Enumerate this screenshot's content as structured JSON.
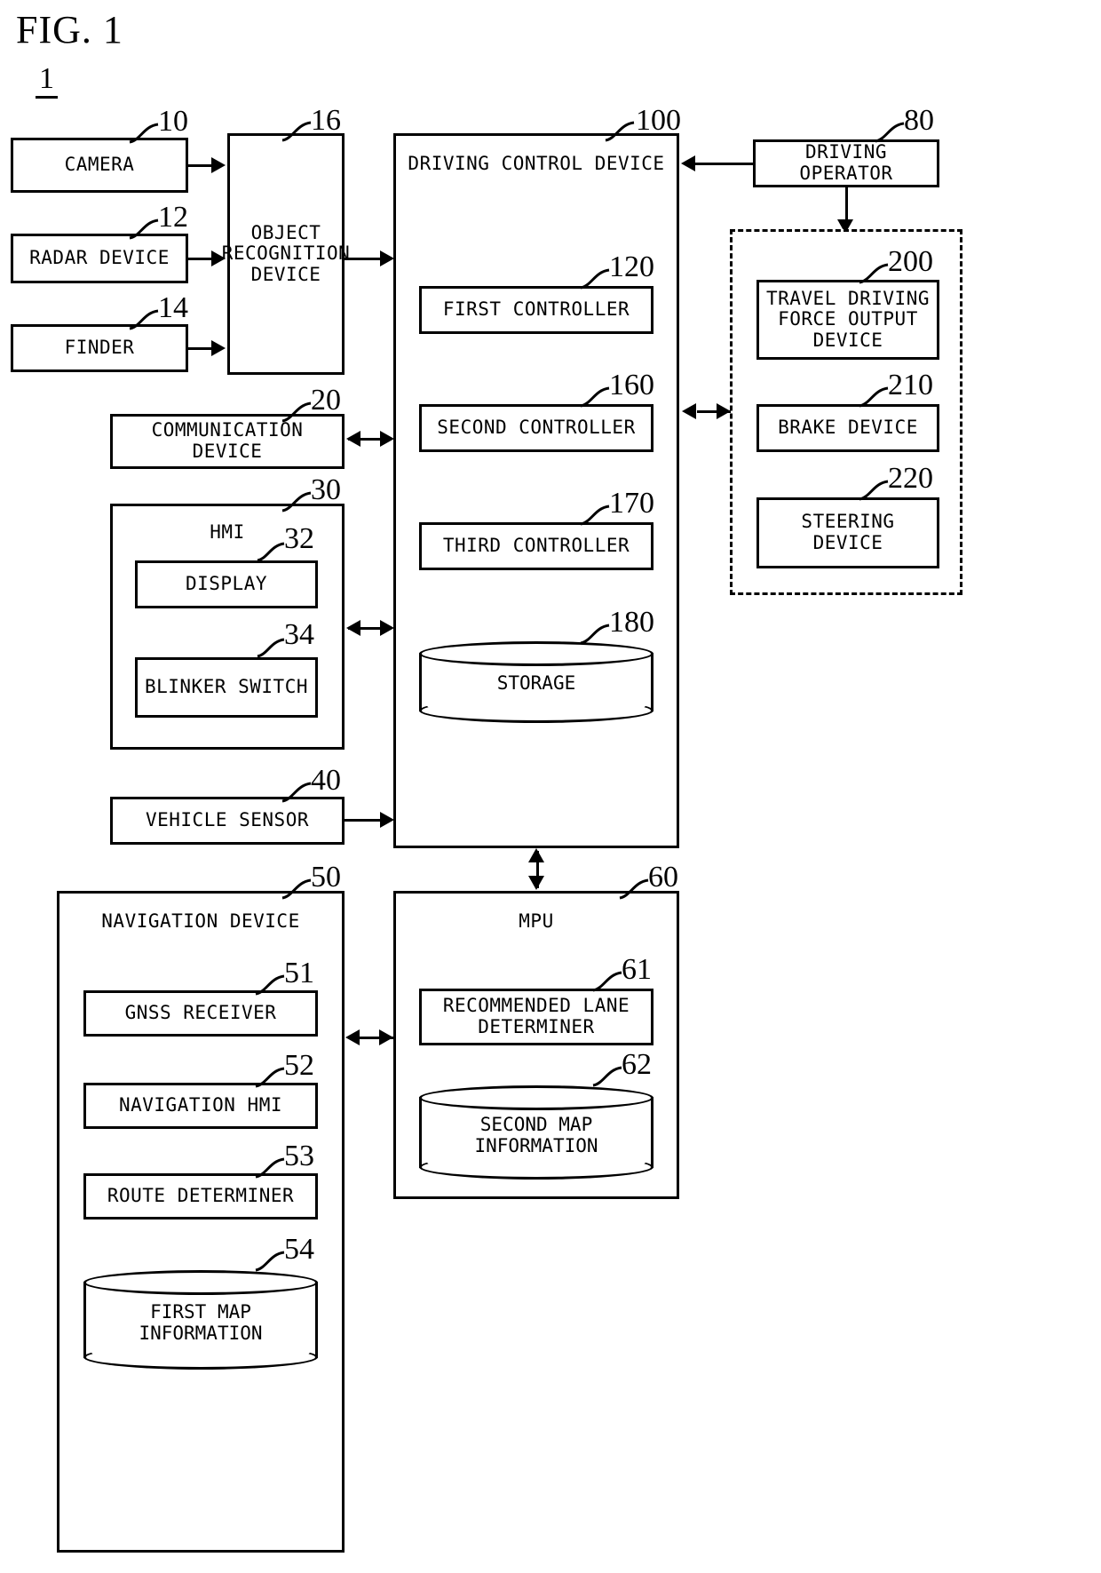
{
  "figure": {
    "title": "FIG. 1",
    "system_number": "1"
  },
  "blocks": {
    "camera": {
      "label": "CAMERA",
      "ref": "10"
    },
    "radar_device": {
      "label": "RADAR DEVICE",
      "ref": "12"
    },
    "finder": {
      "label": "FINDER",
      "ref": "14"
    },
    "object_recognition": {
      "label": "OBJECT\nRECOGNITION\nDEVICE",
      "ref": "16"
    },
    "communication_device": {
      "label": "COMMUNICATION\nDEVICE",
      "ref": "20"
    },
    "hmi": {
      "label": "HMI",
      "ref": "30"
    },
    "display": {
      "label": "DISPLAY",
      "ref": "32"
    },
    "blinker_switch": {
      "label": "BLINKER SWITCH",
      "ref": "34"
    },
    "vehicle_sensor": {
      "label": "VEHICLE SENSOR",
      "ref": "40"
    },
    "navigation_device": {
      "label": "NAVIGATION DEVICE",
      "ref": "50"
    },
    "gnss_receiver": {
      "label": "GNSS RECEIVER",
      "ref": "51"
    },
    "navigation_hmi": {
      "label": "NAVIGATION HMI",
      "ref": "52"
    },
    "route_determiner": {
      "label": "ROUTE DETERMINER",
      "ref": "53"
    },
    "first_map_information": {
      "label": "FIRST MAP\nINFORMATION",
      "ref": "54"
    },
    "mpu": {
      "label": "MPU",
      "ref": "60"
    },
    "recommended_lane": {
      "label": "RECOMMENDED LANE\nDETERMINER",
      "ref": "61"
    },
    "second_map_information": {
      "label": "SECOND MAP\nINFORMATION",
      "ref": "62"
    },
    "driving_operator": {
      "label": "DRIVING OPERATOR",
      "ref": "80"
    },
    "driving_control": {
      "label": "DRIVING CONTROL DEVICE",
      "ref": "100"
    },
    "first_controller": {
      "label": "FIRST CONTROLLER",
      "ref": "120"
    },
    "second_controller": {
      "label": "SECOND CONTROLLER",
      "ref": "160"
    },
    "third_controller": {
      "label": "THIRD CONTROLLER",
      "ref": "170"
    },
    "storage": {
      "label": "STORAGE",
      "ref": "180"
    },
    "travel_driving_force": {
      "label": "TRAVEL DRIVING\nFORCE OUTPUT\nDEVICE",
      "ref": "200"
    },
    "brake_device": {
      "label": "BRAKE DEVICE",
      "ref": "210"
    },
    "steering_device": {
      "label": "STEERING\nDEVICE",
      "ref": "220"
    }
  },
  "colors": {
    "line": "#000000",
    "background": "#ffffff"
  }
}
